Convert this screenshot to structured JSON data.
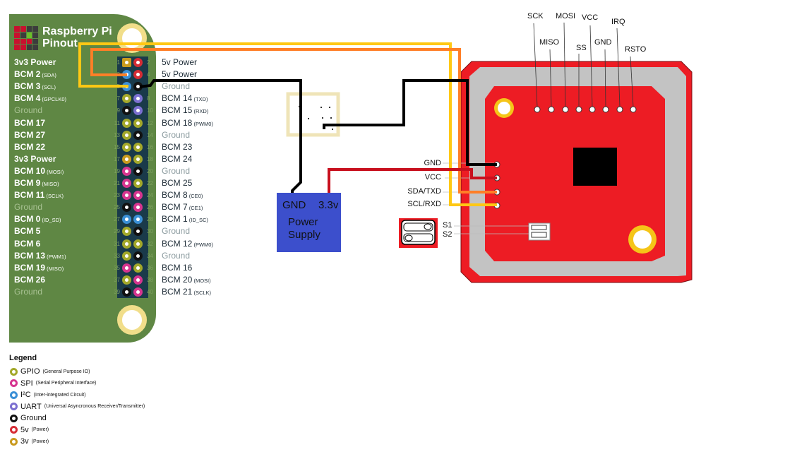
{
  "pi": {
    "title_line1": "Raspberry Pi",
    "title_line2": "Pinout",
    "pins": [
      {
        "n": 1,
        "type": "3v"
      },
      {
        "n": 2,
        "type": "5v"
      },
      {
        "n": 3,
        "type": "i2c"
      },
      {
        "n": 4,
        "type": "5v"
      },
      {
        "n": 5,
        "type": "i2c"
      },
      {
        "n": 6,
        "type": "ground"
      },
      {
        "n": 7,
        "type": "gpio"
      },
      {
        "n": 8,
        "type": "uart"
      },
      {
        "n": 9,
        "type": "ground"
      },
      {
        "n": 10,
        "type": "uart"
      },
      {
        "n": 11,
        "type": "gpio"
      },
      {
        "n": 12,
        "type": "gpio"
      },
      {
        "n": 13,
        "type": "gpio"
      },
      {
        "n": 14,
        "type": "ground"
      },
      {
        "n": 15,
        "type": "gpio"
      },
      {
        "n": 16,
        "type": "gpio"
      },
      {
        "n": 17,
        "type": "3v"
      },
      {
        "n": 18,
        "type": "gpio"
      },
      {
        "n": 19,
        "type": "spi"
      },
      {
        "n": 20,
        "type": "ground"
      },
      {
        "n": 21,
        "type": "spi"
      },
      {
        "n": 22,
        "type": "gpio"
      },
      {
        "n": 23,
        "type": "spi"
      },
      {
        "n": 24,
        "type": "spi"
      },
      {
        "n": 25,
        "type": "ground"
      },
      {
        "n": 26,
        "type": "spi"
      },
      {
        "n": 27,
        "type": "i2c"
      },
      {
        "n": 28,
        "type": "i2c"
      },
      {
        "n": 29,
        "type": "gpio"
      },
      {
        "n": 30,
        "type": "ground"
      },
      {
        "n": 31,
        "type": "gpio"
      },
      {
        "n": 32,
        "type": "gpio"
      },
      {
        "n": 33,
        "type": "gpio"
      },
      {
        "n": 34,
        "type": "ground"
      },
      {
        "n": 35,
        "type": "spi"
      },
      {
        "n": 36,
        "type": "gpio"
      },
      {
        "n": 37,
        "type": "gpio"
      },
      {
        "n": 38,
        "type": "spi"
      },
      {
        "n": 39,
        "type": "ground"
      },
      {
        "n": 40,
        "type": "spi"
      }
    ],
    "left_labels": [
      {
        "main": "3v3 Power",
        "sub": ""
      },
      {
        "main": "BCM 2",
        "sub": "(SDA)"
      },
      {
        "main": "BCM 3",
        "sub": "(SCL)"
      },
      {
        "main": "BCM 4",
        "sub": "(GPCLK0)"
      },
      {
        "main": "Ground",
        "sub": "",
        "gnd": true
      },
      {
        "main": "BCM 17",
        "sub": ""
      },
      {
        "main": "BCM 27",
        "sub": ""
      },
      {
        "main": "BCM 22",
        "sub": ""
      },
      {
        "main": "3v3 Power",
        "sub": ""
      },
      {
        "main": "BCM 10",
        "sub": "(MOSI)"
      },
      {
        "main": "BCM 9",
        "sub": "(MISO)"
      },
      {
        "main": "BCM 11",
        "sub": "(SCLK)"
      },
      {
        "main": "Ground",
        "sub": "",
        "gnd": true
      },
      {
        "main": "BCM 0",
        "sub": "(ID_SD)"
      },
      {
        "main": "BCM 5",
        "sub": ""
      },
      {
        "main": "BCM 6",
        "sub": ""
      },
      {
        "main": "BCM 13",
        "sub": "(PWM1)"
      },
      {
        "main": "BCM 19",
        "sub": "(MISO)"
      },
      {
        "main": "BCM 26",
        "sub": ""
      },
      {
        "main": "Ground",
        "sub": "",
        "gnd": true
      }
    ],
    "right_labels": [
      {
        "main": "5v Power",
        "sub": ""
      },
      {
        "main": "5v Power",
        "sub": ""
      },
      {
        "main": "Ground",
        "sub": "",
        "gnd": true
      },
      {
        "main": "BCM 14",
        "sub": "(TXD)"
      },
      {
        "main": "BCM 15",
        "sub": "(RXD)"
      },
      {
        "main": "BCM 18",
        "sub": "(PWM0)"
      },
      {
        "main": "Ground",
        "sub": "",
        "gnd": true
      },
      {
        "main": "BCM 23",
        "sub": ""
      },
      {
        "main": "BCM 24",
        "sub": ""
      },
      {
        "main": "Ground",
        "sub": "",
        "gnd": true
      },
      {
        "main": "BCM 25",
        "sub": ""
      },
      {
        "main": "BCM 8",
        "sub": "(CE0)"
      },
      {
        "main": "BCM 7",
        "sub": "(CE1)"
      },
      {
        "main": "BCM 1",
        "sub": "(ID_SC)"
      },
      {
        "main": "Ground",
        "sub": "",
        "gnd": true
      },
      {
        "main": "BCM 12",
        "sub": "(PWM0)"
      },
      {
        "main": "Ground",
        "sub": "",
        "gnd": true
      },
      {
        "main": "BCM 16",
        "sub": ""
      },
      {
        "main": "BCM 20",
        "sub": "(MOSI)"
      },
      {
        "main": "BCM 21",
        "sub": "(SCLK)"
      }
    ]
  },
  "legend": {
    "title": "Legend",
    "items": [
      {
        "type": "gpio",
        "label": "GPIO",
        "sub": "(General Purpose IO)"
      },
      {
        "type": "spi",
        "label": "SPI",
        "sub": "(Serial Peripheral Interface)"
      },
      {
        "type": "i2c",
        "label": "I²C",
        "sub": "(Inter-integrated Circuit)"
      },
      {
        "type": "uart",
        "label": "UART",
        "sub": "(Universal Asyncronous Receiver/Transmitter)"
      },
      {
        "type": "ground",
        "label": "Ground",
        "sub": ""
      },
      {
        "type": "5v",
        "label": "5v",
        "sub": "(Power)"
      },
      {
        "type": "3v",
        "label": "3v",
        "sub": "(Power)"
      }
    ]
  },
  "colors": {
    "gpio": "#a3a82a",
    "spi": "#d6358f",
    "i2c": "#3a8fd6",
    "uart": "#7b6fd0",
    "ground": "#111111",
    "5v": "#d62c35",
    "3v": "#c99a1e",
    "wire_yellow": "#ffc814",
    "wire_orange": "#ff7f27",
    "wire_red": "#c8101e",
    "wire_black": "#000000",
    "module_red": "#ed1c24",
    "module_gray": "#c3c3c3"
  },
  "power_supply": {
    "gnd_label": "GND",
    "v_label": "3.3v",
    "title_line1": "Power",
    "title_line2": "Supply"
  },
  "module": {
    "top_pins": [
      "SCK",
      "MISO",
      "MOSI",
      "SS",
      "VCC",
      "GND",
      "IRQ",
      "RSTO"
    ],
    "side_pins": [
      "GND",
      "VCC",
      "SDA/TXD",
      "SCL/RXD"
    ],
    "switches": [
      "S1",
      "S2"
    ]
  }
}
